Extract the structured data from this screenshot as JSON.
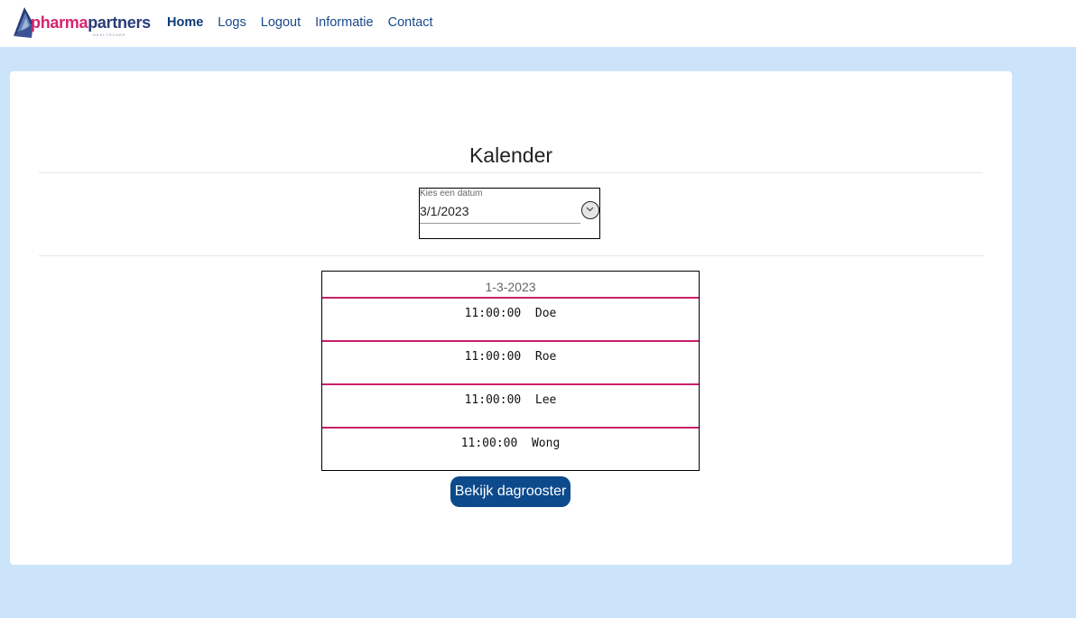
{
  "brand": {
    "name_part1": "pharma",
    "name_part2": "partners",
    "tagline": "HEALTHCARE"
  },
  "nav": {
    "items": [
      {
        "label": "Home",
        "active": true
      },
      {
        "label": "Logs"
      },
      {
        "label": "Logout"
      },
      {
        "label": "Informatie"
      },
      {
        "label": "Contact"
      }
    ]
  },
  "page": {
    "title": "Kalender"
  },
  "datepicker": {
    "label": "Kies een datum",
    "value": "3/1/2023"
  },
  "schedule": {
    "date": "1-3-2023",
    "rows": [
      {
        "time": "11:00:00",
        "name": "Doe"
      },
      {
        "time": "11:00:00",
        "name": "Roe"
      },
      {
        "time": "11:00:00",
        "name": "Lee"
      },
      {
        "time": "11:00:00",
        "name": "Wong"
      }
    ]
  },
  "actions": {
    "view_day_label": "Bekijk dagrooster"
  },
  "colors": {
    "accent": "#c8206a",
    "primary": "#0c4a8c",
    "background": "#cce4fa"
  }
}
